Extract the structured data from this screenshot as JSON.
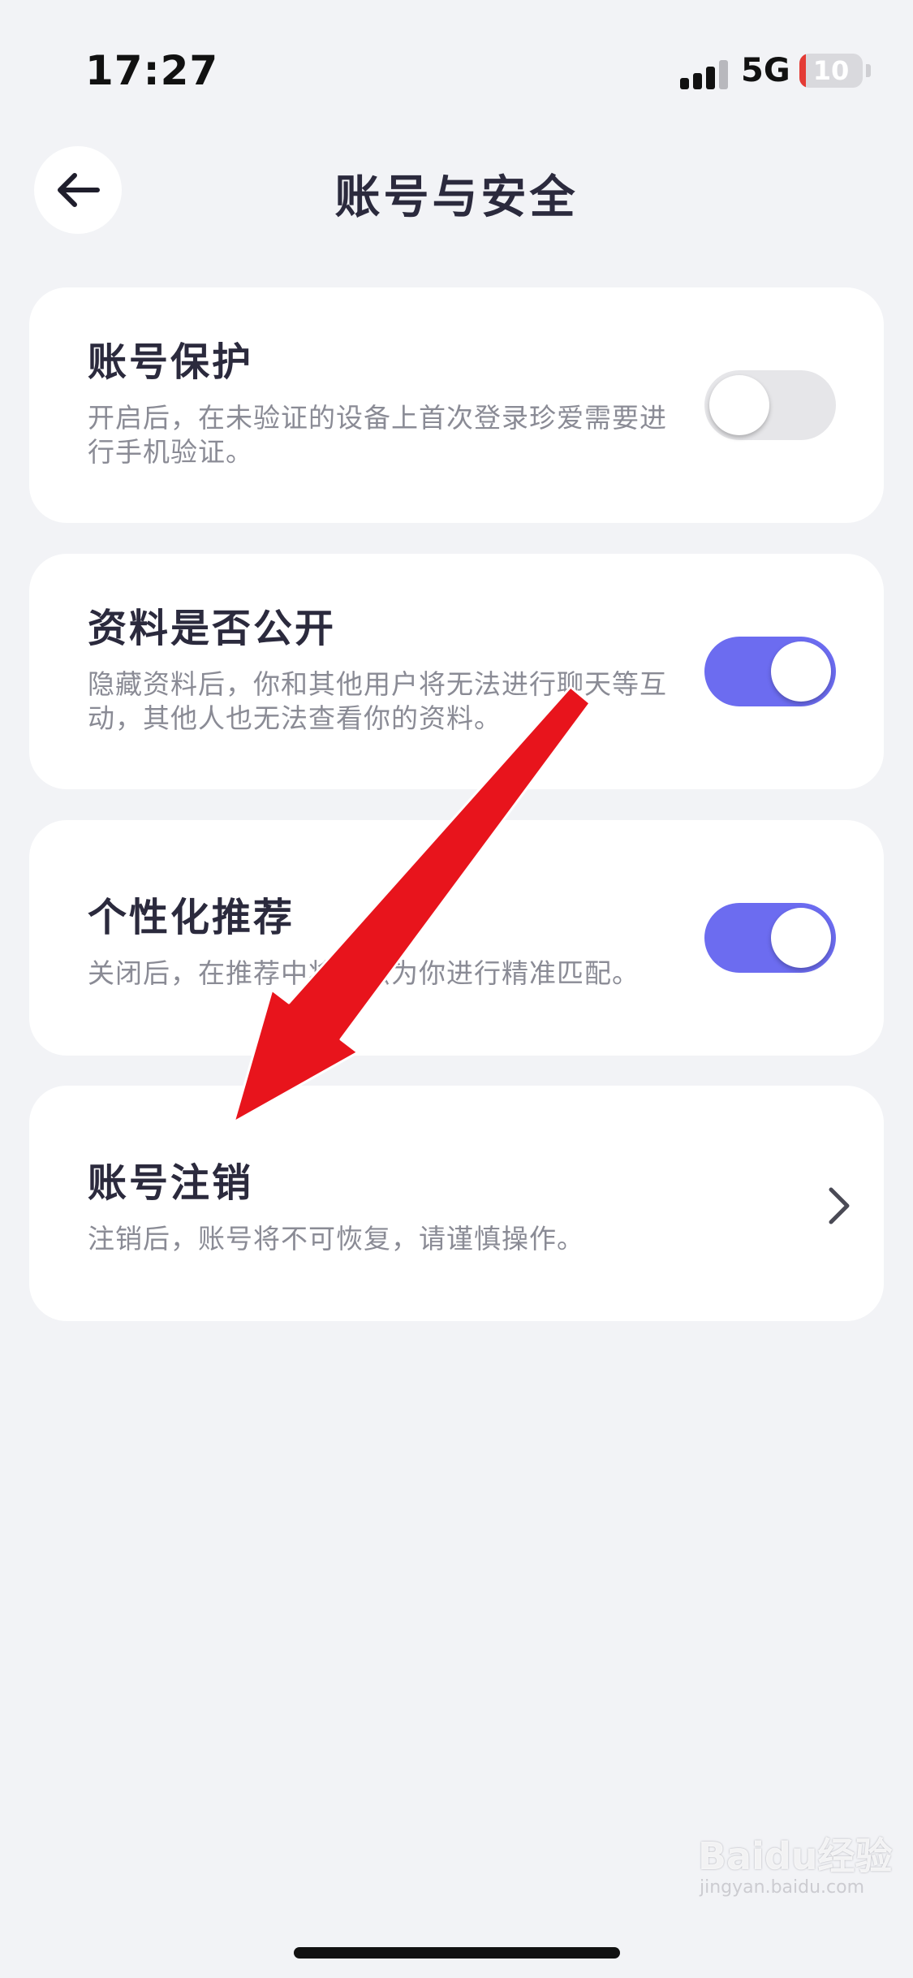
{
  "status_bar": {
    "time": "17:27",
    "network": "5G",
    "battery": "10",
    "battery_fraction": 0.1,
    "icons": [
      "signal-icon",
      "battery-icon"
    ]
  },
  "header": {
    "title": "账号与安全",
    "back_icon": "arrow-left-icon"
  },
  "settings": [
    {
      "title": "账号保护",
      "description": "开启后，在未验证的设备上首次登录珍爱需要进行手机验证。",
      "control": "toggle",
      "enabled": false
    },
    {
      "title": "资料是否公开",
      "description": "隐藏资料后，你和其他用户将无法进行聊天等互动，其他人也无法查看你的资料。",
      "control": "toggle",
      "enabled": true
    },
    {
      "title": "个性化推荐",
      "description": "关闭后，在推荐中将无法为你进行精准匹配。",
      "control": "toggle",
      "enabled": true
    },
    {
      "title": "账号注销",
      "description": "注销后，账号将不可恢复，请谨慎操作。",
      "control": "chevron",
      "icon": "chevron-right-icon"
    }
  ],
  "colors": {
    "background": "#f2f3f6",
    "card": "#ffffff",
    "toggle_on": "#6c6cf0",
    "toggle_off": "#e6e6e9",
    "annotation_arrow": "#e8141c"
  },
  "watermark": {
    "text": "Baidu经验",
    "sub": "jingyan.baidu.com"
  }
}
